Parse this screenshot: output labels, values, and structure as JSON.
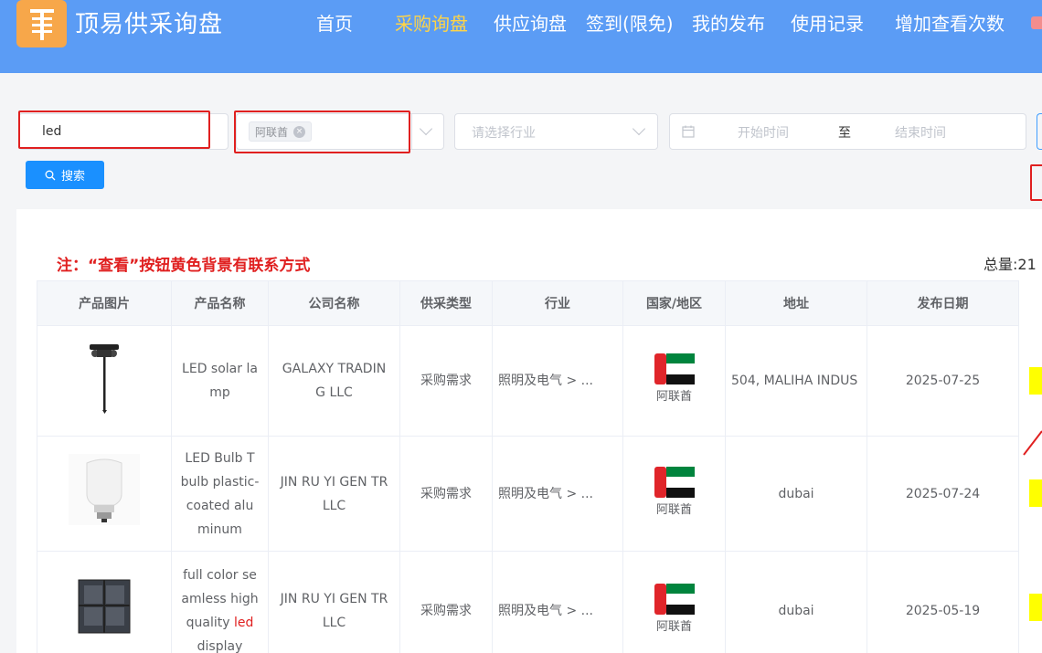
{
  "header": {
    "brand": "顶易供采询盘",
    "nav": [
      {
        "label": "首页",
        "active": false
      },
      {
        "label": "采购询盘",
        "active": true
      },
      {
        "label": "供应询盘",
        "active": false
      },
      {
        "label": "签到(限免)",
        "active": false
      },
      {
        "label": "我的发布",
        "active": false
      },
      {
        "label": "使用记录",
        "active": false
      },
      {
        "label": "增加查看次数",
        "active": false
      }
    ]
  },
  "filters": {
    "keyword": "led",
    "country_tag": "阿联酋",
    "industry_placeholder": "请选择行业",
    "start_placeholder": "开始时间",
    "range_sep": "至",
    "end_placeholder": "结束时间",
    "search_label": "搜索"
  },
  "note": "注：“查看”按钮黄色背景有联系方式",
  "total": "总量:21",
  "table": {
    "headers": [
      "产品图片",
      "产品名称",
      "公司名称",
      "供采类型",
      "行业",
      "国家/地区",
      "地址",
      "发布日期"
    ],
    "rows": [
      {
        "product_pre": "LED solar lamp",
        "product_hl": "",
        "product_post": "",
        "company": "GALAXY TRADING LLC",
        "type": "采购需求",
        "industry": "照明及电气 > ...",
        "country": "阿联酋",
        "address": "504, MALIHA INDUS",
        "date": "2025-07-25"
      },
      {
        "product_pre": "LED Bulb T bulb plastic-coated aluminum",
        "product_hl": "",
        "product_post": "",
        "company": "JIN RU YI GEN TR LLC",
        "type": "采购需求",
        "industry": "照明及电气 > ...",
        "country": "阿联酋",
        "address": "dubai",
        "date": "2025-07-24"
      },
      {
        "product_pre": "full color seamless high quality ",
        "product_hl": "led",
        "product_post": " display",
        "company": "JIN RU YI GEN TR LLC",
        "type": "采购需求",
        "industry": "照明及电气 > ...",
        "country": "阿联酋",
        "address": "dubai",
        "date": "2025-05-19"
      }
    ]
  },
  "colors": {
    "header_bg": "#5b9cf5",
    "nav_active": "#ffd447",
    "logo_bg": "#f7a74a",
    "primary_btn": "#1a90ff",
    "highlight_red": "#e02020",
    "view_btn_yellow": "#ffff00"
  }
}
